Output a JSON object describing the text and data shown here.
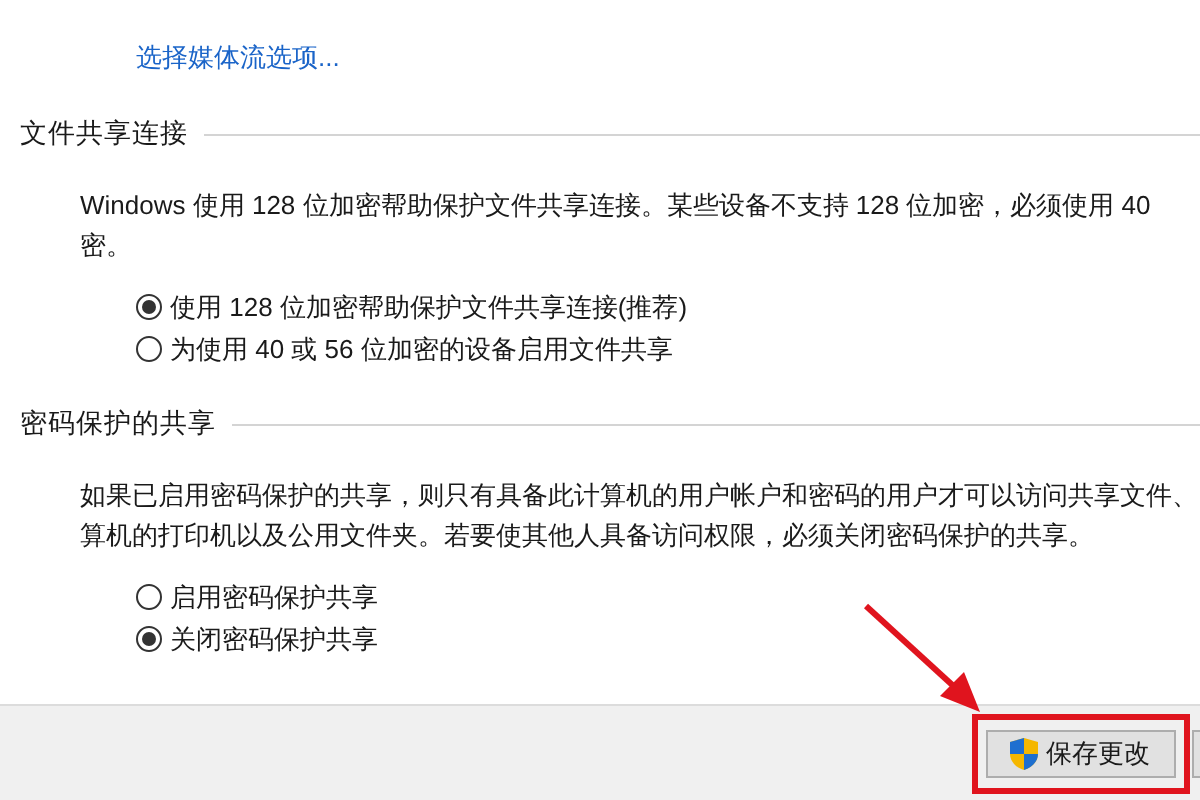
{
  "link": "选择媒体流选项...",
  "sections": [
    {
      "heading": "文件共享连接",
      "description": [
        "Windows 使用 128 位加密帮助保护文件共享连接。某些设备不支持 128 位加密，必须使用 40",
        "密。"
      ],
      "options": [
        {
          "label": "使用 128 位加密帮助保护文件共享连接(推荐)",
          "selected": true
        },
        {
          "label": "为使用 40 或 56 位加密的设备启用文件共享",
          "selected": false
        }
      ]
    },
    {
      "heading": "密码保护的共享",
      "description": [
        "如果已启用密码保护的共享，则只有具备此计算机的用户帐户和密码的用户才可以访问共享文件、",
        "算机的打印机以及公用文件夹。若要使其他人具备访问权限，必须关闭密码保护的共享。"
      ],
      "options": [
        {
          "label": "启用密码保护共享",
          "selected": false
        },
        {
          "label": "关闭密码保护共享",
          "selected": true
        }
      ]
    }
  ],
  "footer": {
    "buttons": [
      {
        "label": "保存更改",
        "kind": "shield",
        "highlighted": true
      },
      {
        "kind": "plain"
      }
    ]
  }
}
